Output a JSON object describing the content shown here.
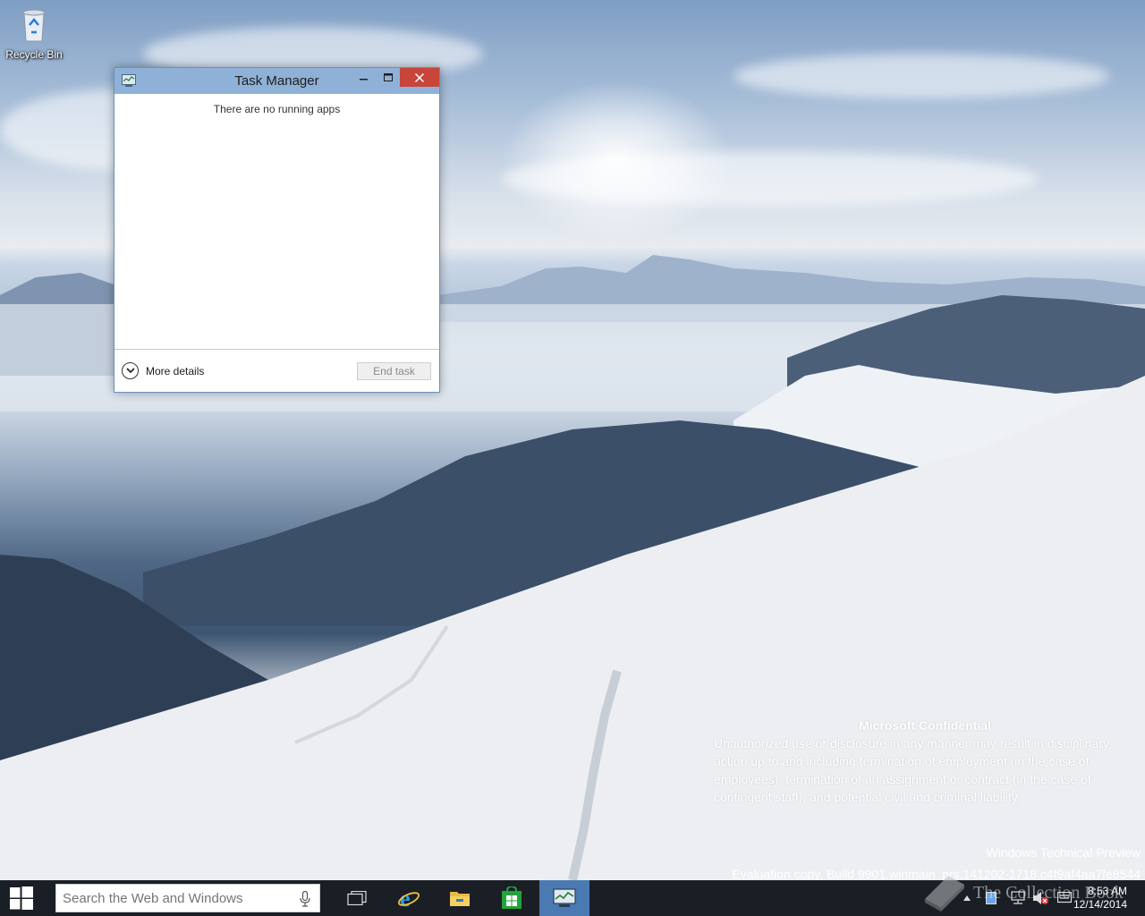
{
  "desktop": {
    "recycle_bin_label": "Recycle Bin"
  },
  "task_manager": {
    "title": "Task Manager",
    "empty_message": "There are no running apps",
    "more_details_label": "More details",
    "end_task_label": "End task",
    "minimize_glyph": "—",
    "maximize_glyph": "☐",
    "close_glyph": "✕"
  },
  "watermark": {
    "heading": "Microsoft Confidential",
    "lines": [
      "Unauthorized use or disclosure in any manner may result in disciplinary",
      "action up to and including termination of employment (in the case of",
      "employees), termination of an assignment or contract (in the case of",
      "contingent staff), and potential civil and criminal liability."
    ],
    "edition": "Windows Technical Preview",
    "build": "Evaluation copy. Build 9901.winmain_prs.141202-1718.c4f9af4aa7fe8544"
  },
  "overlay": {
    "collection_text": "The Collection Book"
  },
  "taskbar": {
    "search_placeholder": "Search the Web and Windows",
    "time": "8:53 AM",
    "date": "12/14/2014",
    "pinned": [
      "task-view-icon",
      "internet-explorer-icon",
      "file-explorer-icon",
      "store-icon",
      "task-manager-icon"
    ]
  },
  "colors": {
    "titlebar": "#8fb1d7",
    "close_button": "#c7453b",
    "taskbar": "#1a1f26",
    "active_taskbar_item": "#4a7ab1"
  }
}
